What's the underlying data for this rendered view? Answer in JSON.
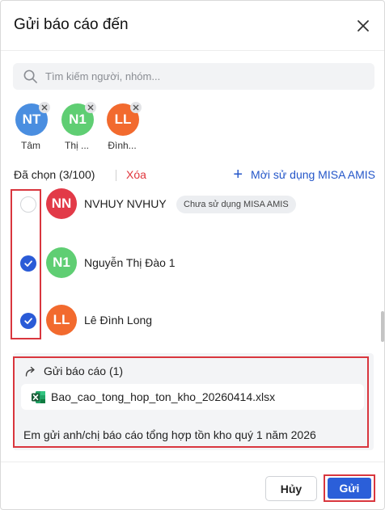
{
  "dialog": {
    "title": "Gửi báo cáo đến"
  },
  "search": {
    "placeholder": "Tìm kiếm người, nhóm..."
  },
  "chips": [
    {
      "initials": "NT",
      "name": "Tâm",
      "color": "#4a8ee0"
    },
    {
      "initials": "N1",
      "name": "Thị ...",
      "color": "#5fce73"
    },
    {
      "initials": "LL",
      "name": "Đình...",
      "color": "#f26a2e"
    }
  ],
  "selection": {
    "count_label": "Đã chọn (3/100)",
    "clear_label": "Xóa",
    "invite_label": "Mời sử dụng MISA AMIS"
  },
  "people": [
    {
      "initials": "NN",
      "name": "NVHUY NVHUY",
      "badge": "Chưa sử dụng MISA AMIS",
      "checked": false,
      "color": "#e23a48"
    },
    {
      "initials": "N1",
      "name": "Nguyễn Thị Đào 1",
      "badge": "",
      "checked": true,
      "color": "#5fce73"
    },
    {
      "initials": "LL",
      "name": "Lê Đình Long",
      "badge": "",
      "checked": true,
      "color": "#f26a2e"
    }
  ],
  "share": {
    "header": "Gửi báo cáo (1)",
    "file_name": "Bao_cao_tong_hop_ton_kho_20260414.xlsx",
    "message": "Em gửi anh/chị báo cáo tổng hợp tồn kho quý 1 năm 2026"
  },
  "footer": {
    "cancel_label": "Hủy",
    "send_label": "Gửi"
  },
  "colors": {
    "accent": "#2b5fd9",
    "danger": "#e0353b",
    "highlight_box": "#d9363e"
  }
}
